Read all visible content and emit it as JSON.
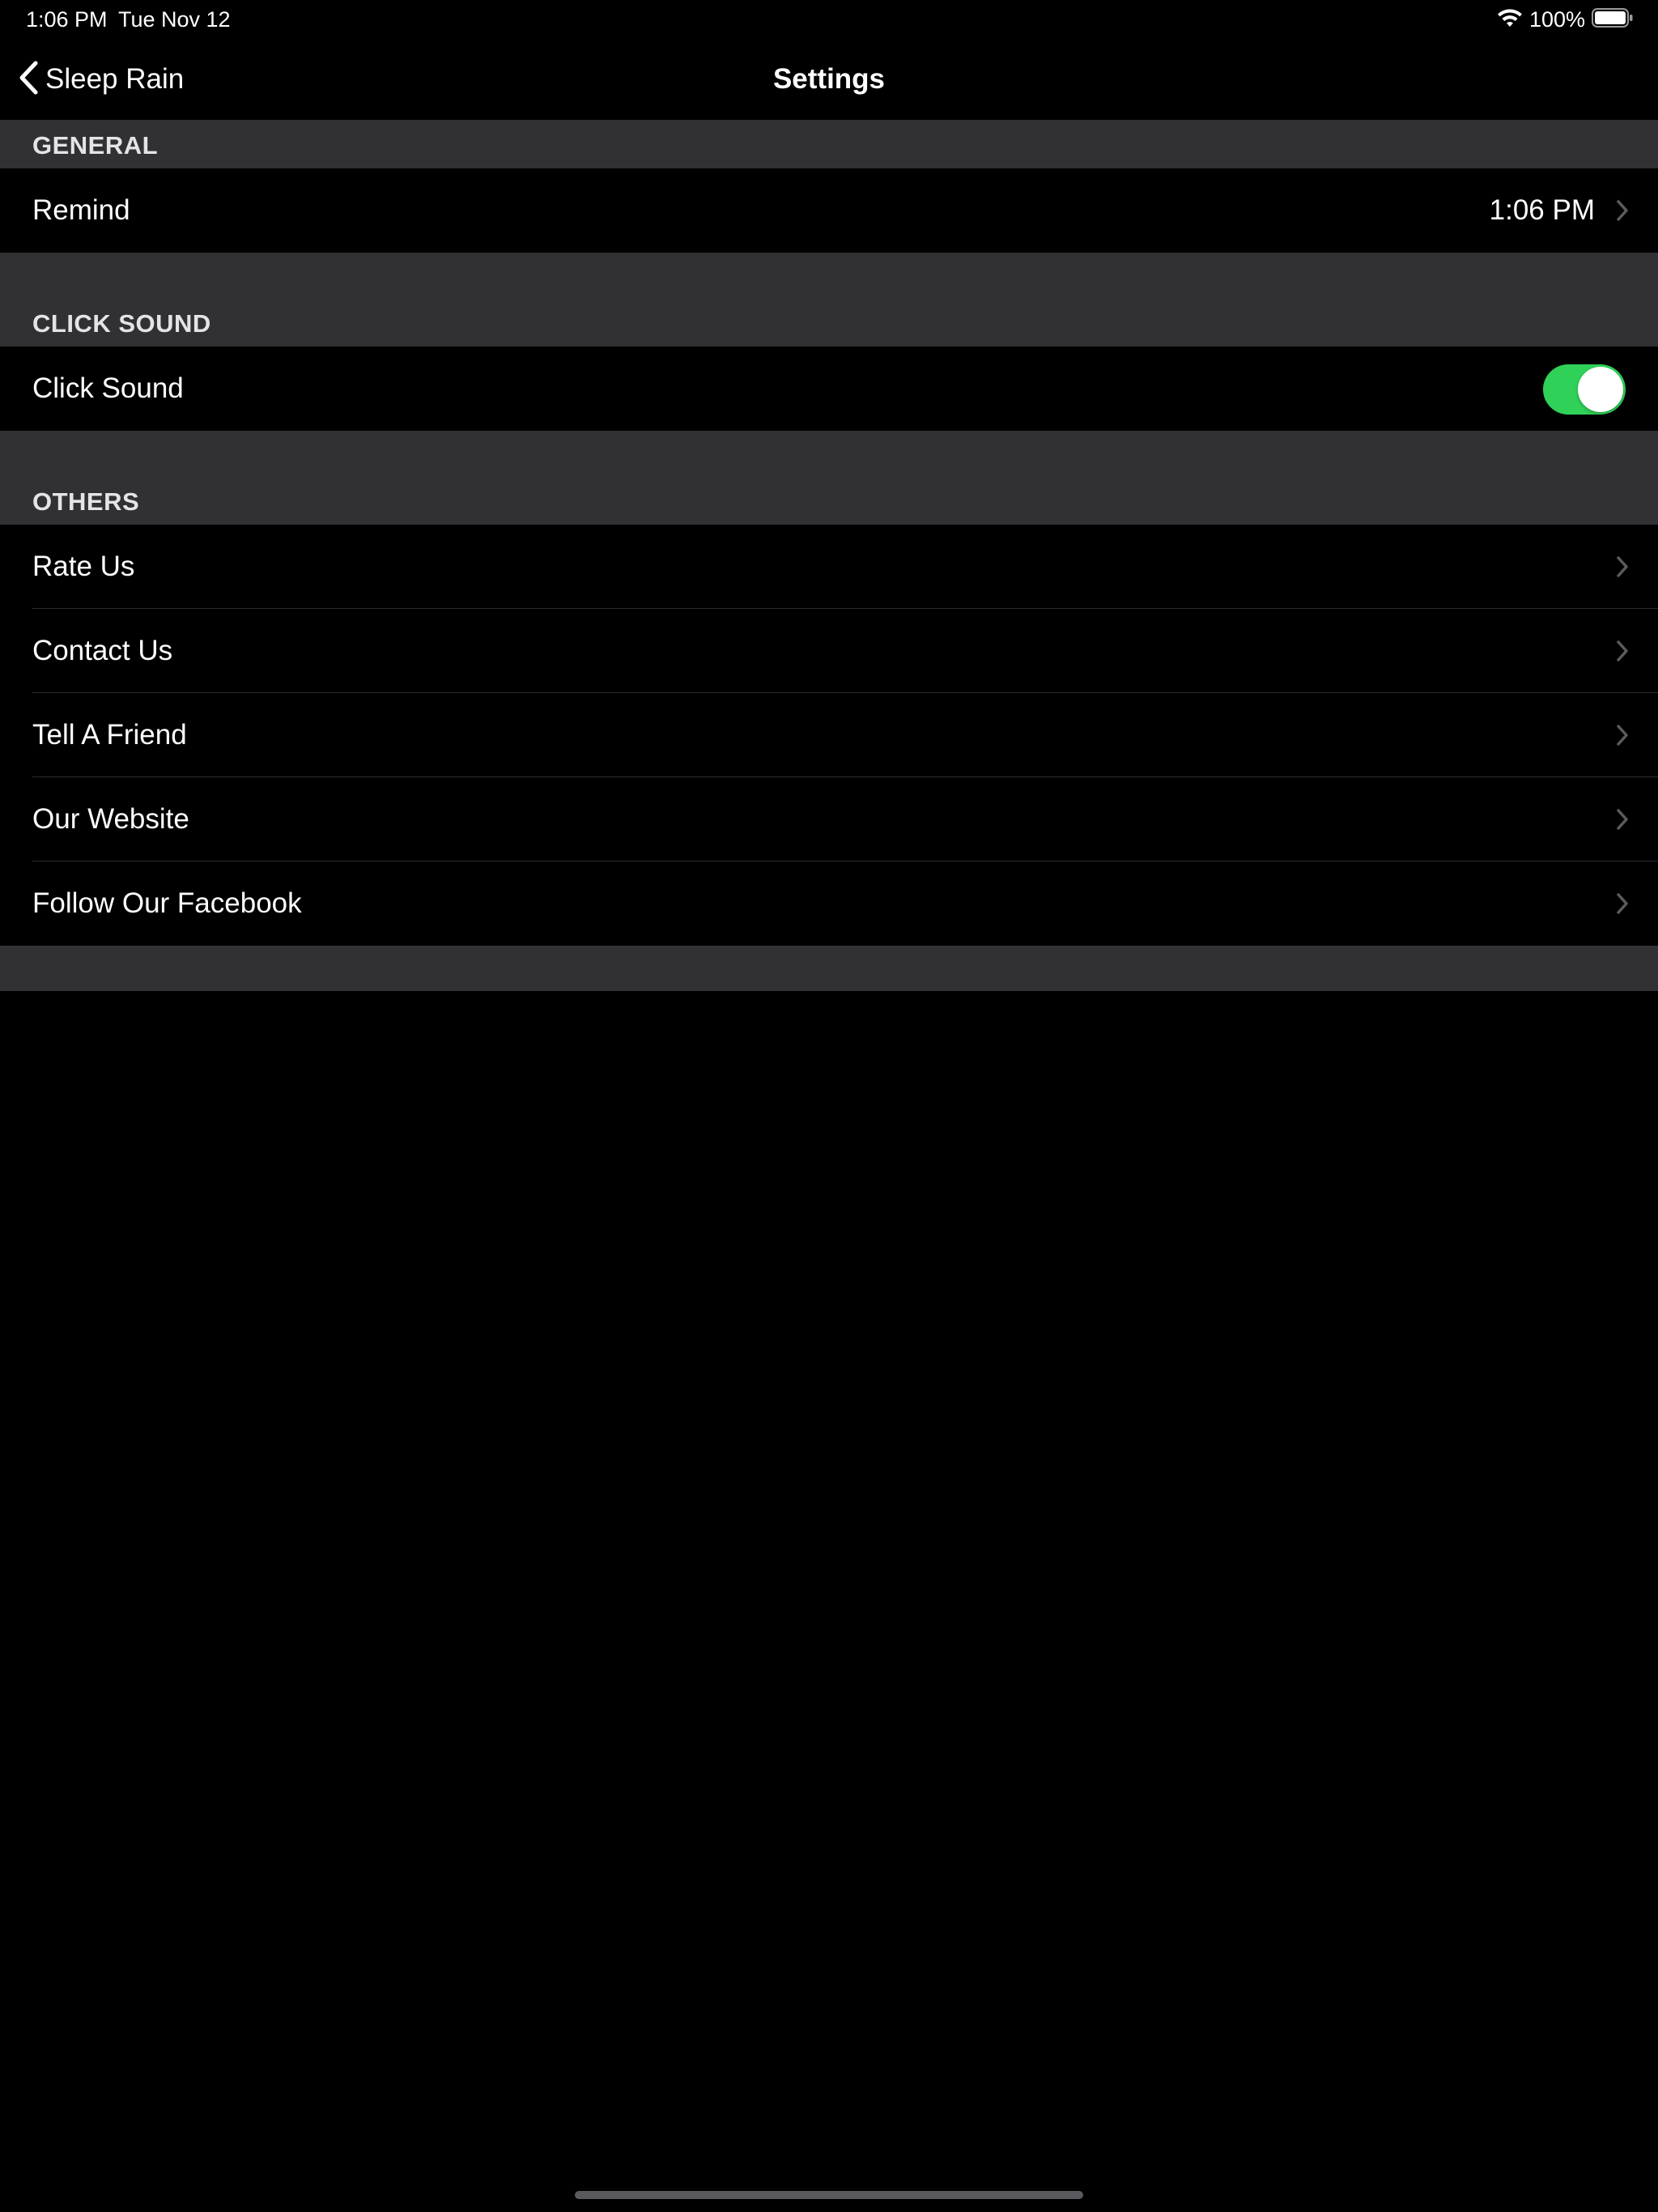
{
  "status_bar": {
    "time": "1:06 PM",
    "date": "Tue Nov 12",
    "battery_percent": "100%",
    "battery_level": 1.0,
    "icons": [
      "wifi-icon",
      "battery-icon"
    ]
  },
  "nav": {
    "back_label": "Sleep Rain",
    "back_icon": "chevron-left-icon",
    "title": "Settings"
  },
  "sections": {
    "general": {
      "header": "GENERAL",
      "remind": {
        "label": "Remind",
        "value": "1:06 PM"
      }
    },
    "click_sound": {
      "header": "CLICK SOUND",
      "click_sound": {
        "label": "Click Sound",
        "enabled": true
      }
    },
    "others": {
      "header": "OTHERS",
      "items": [
        {
          "label": "Rate Us"
        },
        {
          "label": "Contact Us"
        },
        {
          "label": "Tell A Friend"
        },
        {
          "label": "Our Website"
        },
        {
          "label": "Follow Our Facebook"
        }
      ]
    }
  },
  "colors": {
    "background": "#000000",
    "section_header_bg": "#313133",
    "toggle_on": "#30d158",
    "chevron": "#5b5b5f",
    "text": "#ffffff"
  }
}
